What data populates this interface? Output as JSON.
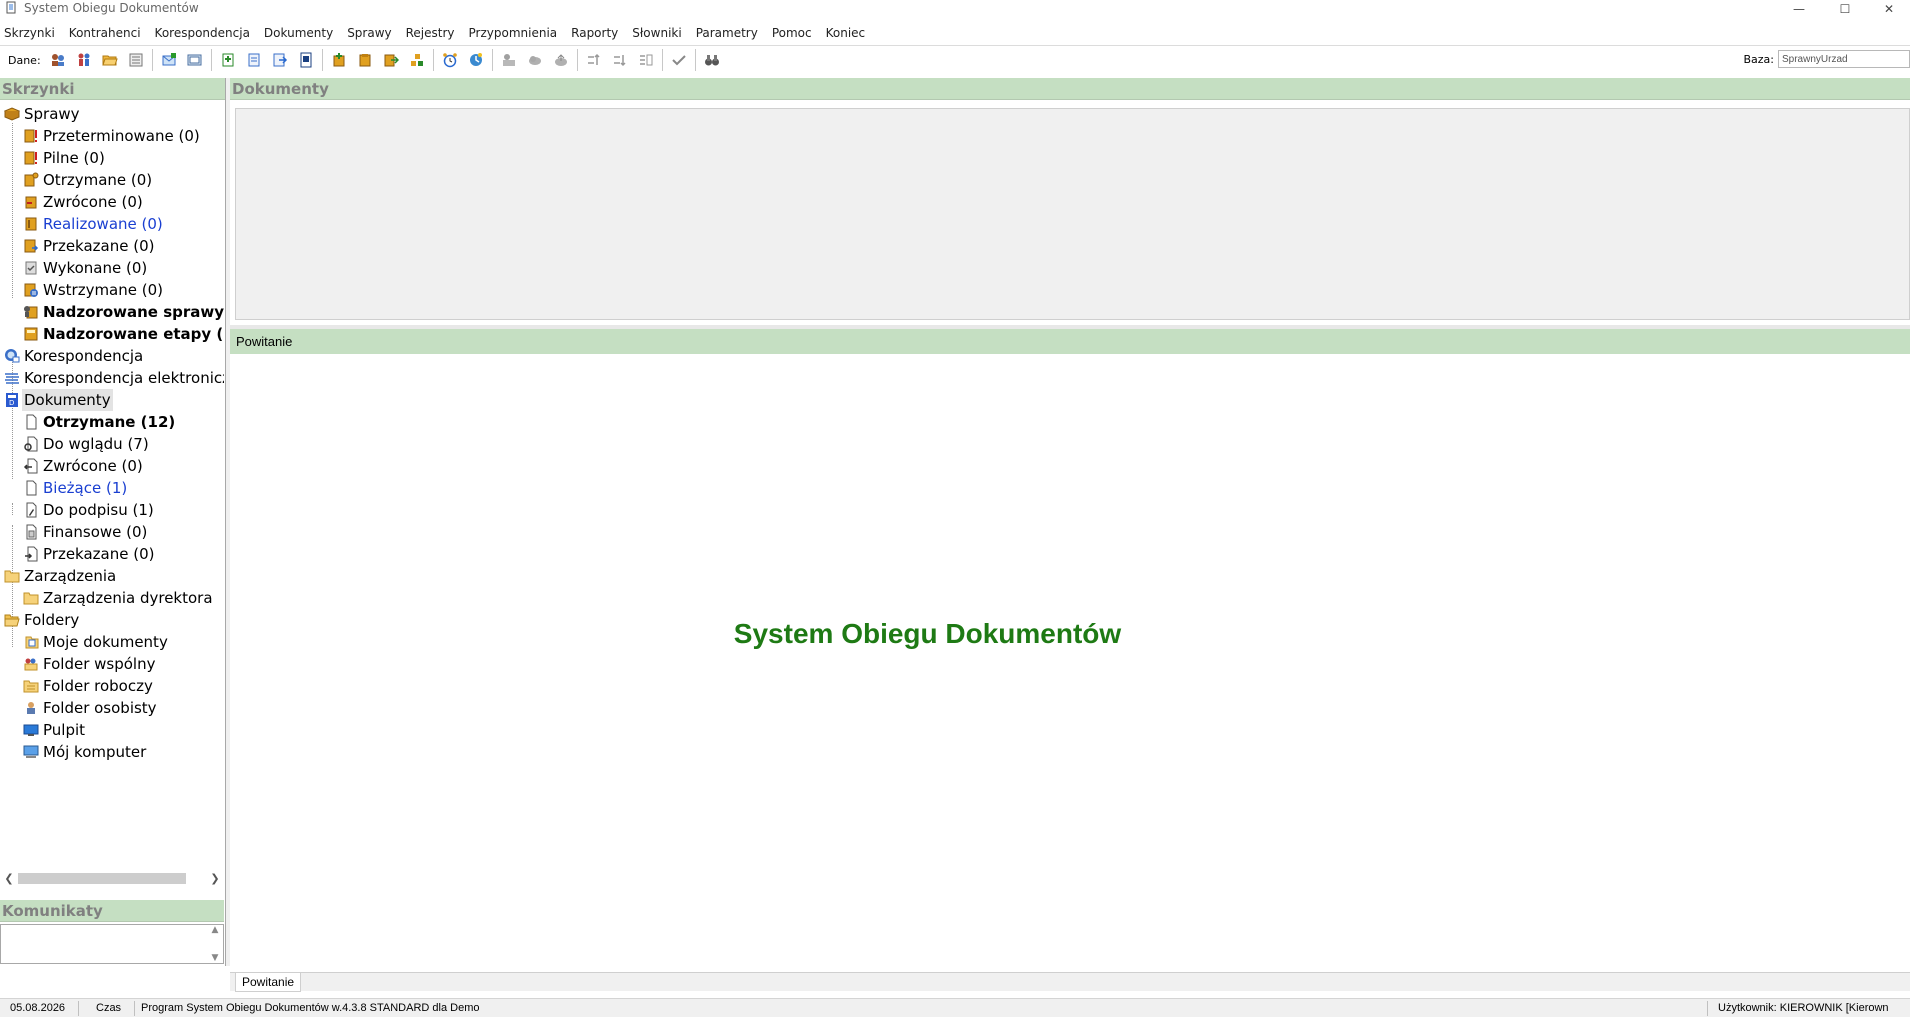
{
  "window": {
    "title": "System Obiegu Dokumentów",
    "minimize_glyph": "—",
    "maximize_glyph": "☐",
    "close_glyph": "✕"
  },
  "menu": [
    "Skrzynki",
    "Kontrahenci",
    "Korespondencja",
    "Dokumenty",
    "Sprawy",
    "Rejestry",
    "Przypomnienia",
    "Raporty",
    "Słowniki",
    "Parametry",
    "Pomoc",
    "Koniec"
  ],
  "toolbar": {
    "data_label": "Dane:",
    "baza_label": "Baza:",
    "baza_value": "SprawnyUrzad"
  },
  "left": {
    "skrzynki_header": "Skrzynki",
    "komunikaty_header": "Komunikaty",
    "tree": [
      {
        "label": "Sprawy",
        "icon": "case-folder-icon"
      },
      {
        "label": "Przeterminowane (0)",
        "icon": "overdue-case-icon"
      },
      {
        "label": "Pilne (0)",
        "icon": "urgent-case-icon"
      },
      {
        "label": "Otrzymane (0)",
        "icon": "received-case-icon"
      },
      {
        "label": "Zwrócone (0)",
        "icon": "returned-case-icon"
      },
      {
        "label": "Realizowane (0)",
        "icon": "in-progress-case-icon"
      },
      {
        "label": "Przekazane (0)",
        "icon": "forwarded-case-icon"
      },
      {
        "label": "Wykonane (0)",
        "icon": "completed-case-icon"
      },
      {
        "label": "Wstrzymane (0)",
        "icon": "suspended-case-icon"
      },
      {
        "label": "Nadzorowane sprawy",
        "icon": "supervised-cases-icon"
      },
      {
        "label": "Nadzorowane etapy (:",
        "icon": "supervised-stages-icon"
      },
      {
        "label": "Korespondencja",
        "icon": "correspondence-icon"
      },
      {
        "label": "Korespondencja elektroniczr",
        "icon": "e-correspondence-icon"
      },
      {
        "label": "Dokumenty",
        "icon": "documents-icon"
      },
      {
        "label": "Otrzymane (12)",
        "icon": "received-document-icon"
      },
      {
        "label": "Do wglądu (7)",
        "icon": "review-document-icon"
      },
      {
        "label": "Zwrócone (0)",
        "icon": "returned-document-icon"
      },
      {
        "label": "Bieżące (1)",
        "icon": "current-document-icon"
      },
      {
        "label": "Do podpisu (1)",
        "icon": "sign-document-icon"
      },
      {
        "label": "Finansowe (0)",
        "icon": "financial-document-icon"
      },
      {
        "label": "Przekazane (0)",
        "icon": "forwarded-document-icon"
      },
      {
        "label": "Zarządzenia",
        "icon": "folder-icon"
      },
      {
        "label": "Zarządzenia dyrektora",
        "icon": "folder-icon"
      },
      {
        "label": "Foldery",
        "icon": "open-folder-icon"
      },
      {
        "label": "Moje dokumenty",
        "icon": "my-documents-icon"
      },
      {
        "label": "Folder wspólny",
        "icon": "shared-folder-icon"
      },
      {
        "label": "Folder roboczy",
        "icon": "work-folder-icon"
      },
      {
        "label": "Folder osobisty",
        "icon": "personal-folder-icon"
      },
      {
        "label": "Pulpit",
        "icon": "desktop-icon"
      },
      {
        "label": "Mój komputer",
        "icon": "computer-icon"
      }
    ]
  },
  "right": {
    "dokumenty_header": "Dokumenty",
    "powitanie_header": "Powitanie",
    "welcome_title": "System Obiegu Dokumentów",
    "tab_label": "Powitanie"
  },
  "status": {
    "date": "05.08.2026",
    "time_label": "Czas",
    "program": "Program System Obiegu Dokumentów w.4.3.8 STANDARD dla Demo",
    "user": "Użytkownik: KIEROWNIK [Kierown"
  },
  "colors": {
    "header_green": "#c5dfc2",
    "title_green": "#1e7a14",
    "link_blue": "#1a3fd1"
  }
}
